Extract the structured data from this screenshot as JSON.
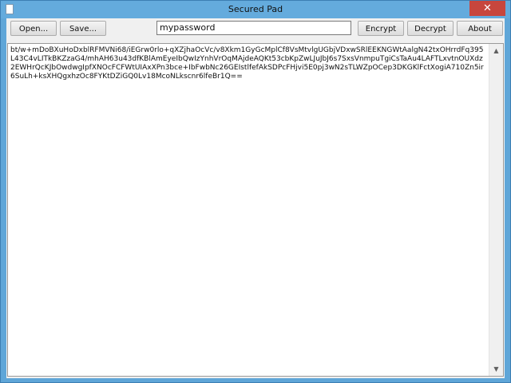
{
  "window": {
    "title": "Secured Pad",
    "close_glyph": "✕"
  },
  "toolbar": {
    "open_label": "Open...",
    "save_label": "Save...",
    "password_value": "mypassword",
    "encrypt_label": "Encrypt",
    "decrypt_label": "Decrypt",
    "about_label": "About"
  },
  "editor": {
    "content": "bt/w+mDoBXuHoDxblRFMVNi68/iEGrw0rlo+qXZjhaOcVc/v8Xkm1GyGcMplCf8VsMtvlgUGbjVDxwSRlEEKNGWtAalgN42txOHrrdFq395L43C4vLITkBKZzaG4/mhAH63u43dfKBlAmEyeIbQwIzYnhVrOqMAjdeAQKt53cbKpZwLJuJbJ6s7SxsVnmpuTgiCsTaAu4LAFTLxvtnOUXdz2EWHrQcKJbOwdwgIpfXNOcFCFWtUIAxXPn3bce+IbFwbNc26GEIstlfefAkSDPcFHjvi5E0pj3wN2sTLWZpOCep3DKGKlFctXogiA710Zn5ir6SuLh+ksXHQgxhzOc8FYKtDZiGQ0Lv18McoNLkscnr6lfeBr1Q==",
    "scroll_up_glyph": "▲",
    "scroll_down_glyph": "▼"
  }
}
